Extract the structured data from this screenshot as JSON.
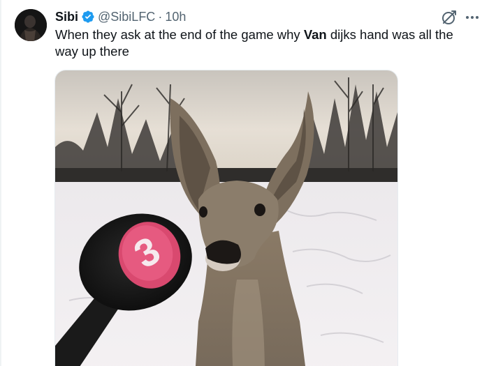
{
  "tweet": {
    "author_name": "Sibi",
    "handle": "@SibiLFC",
    "separator": "·",
    "time": "10h",
    "text_before": "When they ask at the end of the game why ",
    "text_bold": "Van",
    "text_after": " dijks hand was all the way up there"
  },
  "media": {
    "microphone_label": "3"
  },
  "colors": {
    "verified": "#1d9bf0",
    "secondary_text": "#536471",
    "primary_text": "#0f1419"
  },
  "icons": {
    "verified": "verified-badge-icon",
    "grok": "grok-icon",
    "more": "more-options-icon"
  }
}
